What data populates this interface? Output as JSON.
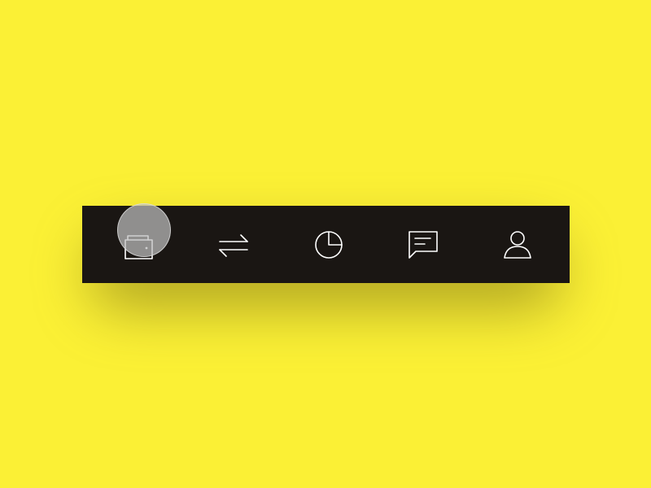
{
  "colors": {
    "background": "#fbf035",
    "tab_bar": "#1a1613",
    "icon": "#ffffff",
    "touch_indicator": "#bebebe"
  },
  "tab_bar": {
    "items": [
      {
        "id": "wallet",
        "icon": "wallet-icon",
        "active": true
      },
      {
        "id": "transfer",
        "icon": "transfer-arrows-icon",
        "active": false
      },
      {
        "id": "statistics",
        "icon": "pie-chart-icon",
        "active": false
      },
      {
        "id": "messages",
        "icon": "chat-bubble-icon",
        "active": false
      },
      {
        "id": "profile",
        "icon": "user-icon",
        "active": false
      }
    ]
  }
}
